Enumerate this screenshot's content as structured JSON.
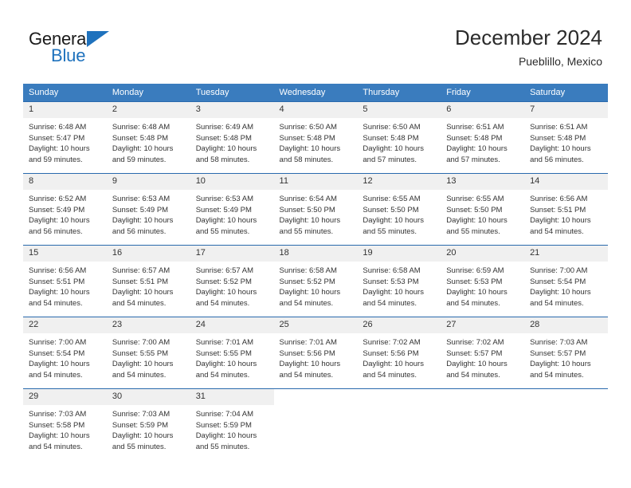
{
  "brand": {
    "name_part1": "General",
    "name_part2": "Blue",
    "flag_icon": "flag-icon"
  },
  "header": {
    "title": "December 2024",
    "location": "Pueblillo, Mexico"
  },
  "calendar": {
    "weekday_headers": [
      "Sunday",
      "Monday",
      "Tuesday",
      "Wednesday",
      "Thursday",
      "Friday",
      "Saturday"
    ],
    "accent_color": "#3a7cbe",
    "grid_line_color": "#2a6aad",
    "daynum_background": "#f0f0f0",
    "weeks": [
      [
        {
          "day": "1",
          "sunrise": "Sunrise: 6:48 AM",
          "sunset": "Sunset: 5:47 PM",
          "daylight_line1": "Daylight: 10 hours",
          "daylight_line2": "and 59 minutes."
        },
        {
          "day": "2",
          "sunrise": "Sunrise: 6:48 AM",
          "sunset": "Sunset: 5:48 PM",
          "daylight_line1": "Daylight: 10 hours",
          "daylight_line2": "and 59 minutes."
        },
        {
          "day": "3",
          "sunrise": "Sunrise: 6:49 AM",
          "sunset": "Sunset: 5:48 PM",
          "daylight_line1": "Daylight: 10 hours",
          "daylight_line2": "and 58 minutes."
        },
        {
          "day": "4",
          "sunrise": "Sunrise: 6:50 AM",
          "sunset": "Sunset: 5:48 PM",
          "daylight_line1": "Daylight: 10 hours",
          "daylight_line2": "and 58 minutes."
        },
        {
          "day": "5",
          "sunrise": "Sunrise: 6:50 AM",
          "sunset": "Sunset: 5:48 PM",
          "daylight_line1": "Daylight: 10 hours",
          "daylight_line2": "and 57 minutes."
        },
        {
          "day": "6",
          "sunrise": "Sunrise: 6:51 AM",
          "sunset": "Sunset: 5:48 PM",
          "daylight_line1": "Daylight: 10 hours",
          "daylight_line2": "and 57 minutes."
        },
        {
          "day": "7",
          "sunrise": "Sunrise: 6:51 AM",
          "sunset": "Sunset: 5:48 PM",
          "daylight_line1": "Daylight: 10 hours",
          "daylight_line2": "and 56 minutes."
        }
      ],
      [
        {
          "day": "8",
          "sunrise": "Sunrise: 6:52 AM",
          "sunset": "Sunset: 5:49 PM",
          "daylight_line1": "Daylight: 10 hours",
          "daylight_line2": "and 56 minutes."
        },
        {
          "day": "9",
          "sunrise": "Sunrise: 6:53 AM",
          "sunset": "Sunset: 5:49 PM",
          "daylight_line1": "Daylight: 10 hours",
          "daylight_line2": "and 56 minutes."
        },
        {
          "day": "10",
          "sunrise": "Sunrise: 6:53 AM",
          "sunset": "Sunset: 5:49 PM",
          "daylight_line1": "Daylight: 10 hours",
          "daylight_line2": "and 55 minutes."
        },
        {
          "day": "11",
          "sunrise": "Sunrise: 6:54 AM",
          "sunset": "Sunset: 5:50 PM",
          "daylight_line1": "Daylight: 10 hours",
          "daylight_line2": "and 55 minutes."
        },
        {
          "day": "12",
          "sunrise": "Sunrise: 6:55 AM",
          "sunset": "Sunset: 5:50 PM",
          "daylight_line1": "Daylight: 10 hours",
          "daylight_line2": "and 55 minutes."
        },
        {
          "day": "13",
          "sunrise": "Sunrise: 6:55 AM",
          "sunset": "Sunset: 5:50 PM",
          "daylight_line1": "Daylight: 10 hours",
          "daylight_line2": "and 55 minutes."
        },
        {
          "day": "14",
          "sunrise": "Sunrise: 6:56 AM",
          "sunset": "Sunset: 5:51 PM",
          "daylight_line1": "Daylight: 10 hours",
          "daylight_line2": "and 54 minutes."
        }
      ],
      [
        {
          "day": "15",
          "sunrise": "Sunrise: 6:56 AM",
          "sunset": "Sunset: 5:51 PM",
          "daylight_line1": "Daylight: 10 hours",
          "daylight_line2": "and 54 minutes."
        },
        {
          "day": "16",
          "sunrise": "Sunrise: 6:57 AM",
          "sunset": "Sunset: 5:51 PM",
          "daylight_line1": "Daylight: 10 hours",
          "daylight_line2": "and 54 minutes."
        },
        {
          "day": "17",
          "sunrise": "Sunrise: 6:57 AM",
          "sunset": "Sunset: 5:52 PM",
          "daylight_line1": "Daylight: 10 hours",
          "daylight_line2": "and 54 minutes."
        },
        {
          "day": "18",
          "sunrise": "Sunrise: 6:58 AM",
          "sunset": "Sunset: 5:52 PM",
          "daylight_line1": "Daylight: 10 hours",
          "daylight_line2": "and 54 minutes."
        },
        {
          "day": "19",
          "sunrise": "Sunrise: 6:58 AM",
          "sunset": "Sunset: 5:53 PM",
          "daylight_line1": "Daylight: 10 hours",
          "daylight_line2": "and 54 minutes."
        },
        {
          "day": "20",
          "sunrise": "Sunrise: 6:59 AM",
          "sunset": "Sunset: 5:53 PM",
          "daylight_line1": "Daylight: 10 hours",
          "daylight_line2": "and 54 minutes."
        },
        {
          "day": "21",
          "sunrise": "Sunrise: 7:00 AM",
          "sunset": "Sunset: 5:54 PM",
          "daylight_line1": "Daylight: 10 hours",
          "daylight_line2": "and 54 minutes."
        }
      ],
      [
        {
          "day": "22",
          "sunrise": "Sunrise: 7:00 AM",
          "sunset": "Sunset: 5:54 PM",
          "daylight_line1": "Daylight: 10 hours",
          "daylight_line2": "and 54 minutes."
        },
        {
          "day": "23",
          "sunrise": "Sunrise: 7:00 AM",
          "sunset": "Sunset: 5:55 PM",
          "daylight_line1": "Daylight: 10 hours",
          "daylight_line2": "and 54 minutes."
        },
        {
          "day": "24",
          "sunrise": "Sunrise: 7:01 AM",
          "sunset": "Sunset: 5:55 PM",
          "daylight_line1": "Daylight: 10 hours",
          "daylight_line2": "and 54 minutes."
        },
        {
          "day": "25",
          "sunrise": "Sunrise: 7:01 AM",
          "sunset": "Sunset: 5:56 PM",
          "daylight_line1": "Daylight: 10 hours",
          "daylight_line2": "and 54 minutes."
        },
        {
          "day": "26",
          "sunrise": "Sunrise: 7:02 AM",
          "sunset": "Sunset: 5:56 PM",
          "daylight_line1": "Daylight: 10 hours",
          "daylight_line2": "and 54 minutes."
        },
        {
          "day": "27",
          "sunrise": "Sunrise: 7:02 AM",
          "sunset": "Sunset: 5:57 PM",
          "daylight_line1": "Daylight: 10 hours",
          "daylight_line2": "and 54 minutes."
        },
        {
          "day": "28",
          "sunrise": "Sunrise: 7:03 AM",
          "sunset": "Sunset: 5:57 PM",
          "daylight_line1": "Daylight: 10 hours",
          "daylight_line2": "and 54 minutes."
        }
      ],
      [
        {
          "day": "29",
          "sunrise": "Sunrise: 7:03 AM",
          "sunset": "Sunset: 5:58 PM",
          "daylight_line1": "Daylight: 10 hours",
          "daylight_line2": "and 54 minutes."
        },
        {
          "day": "30",
          "sunrise": "Sunrise: 7:03 AM",
          "sunset": "Sunset: 5:59 PM",
          "daylight_line1": "Daylight: 10 hours",
          "daylight_line2": "and 55 minutes."
        },
        {
          "day": "31",
          "sunrise": "Sunrise: 7:04 AM",
          "sunset": "Sunset: 5:59 PM",
          "daylight_line1": "Daylight: 10 hours",
          "daylight_line2": "and 55 minutes."
        },
        {
          "day": "",
          "sunrise": "",
          "sunset": "",
          "daylight_line1": "",
          "daylight_line2": ""
        },
        {
          "day": "",
          "sunrise": "",
          "sunset": "",
          "daylight_line1": "",
          "daylight_line2": ""
        },
        {
          "day": "",
          "sunrise": "",
          "sunset": "",
          "daylight_line1": "",
          "daylight_line2": ""
        },
        {
          "day": "",
          "sunrise": "",
          "sunset": "",
          "daylight_line1": "",
          "daylight_line2": ""
        }
      ]
    ]
  }
}
